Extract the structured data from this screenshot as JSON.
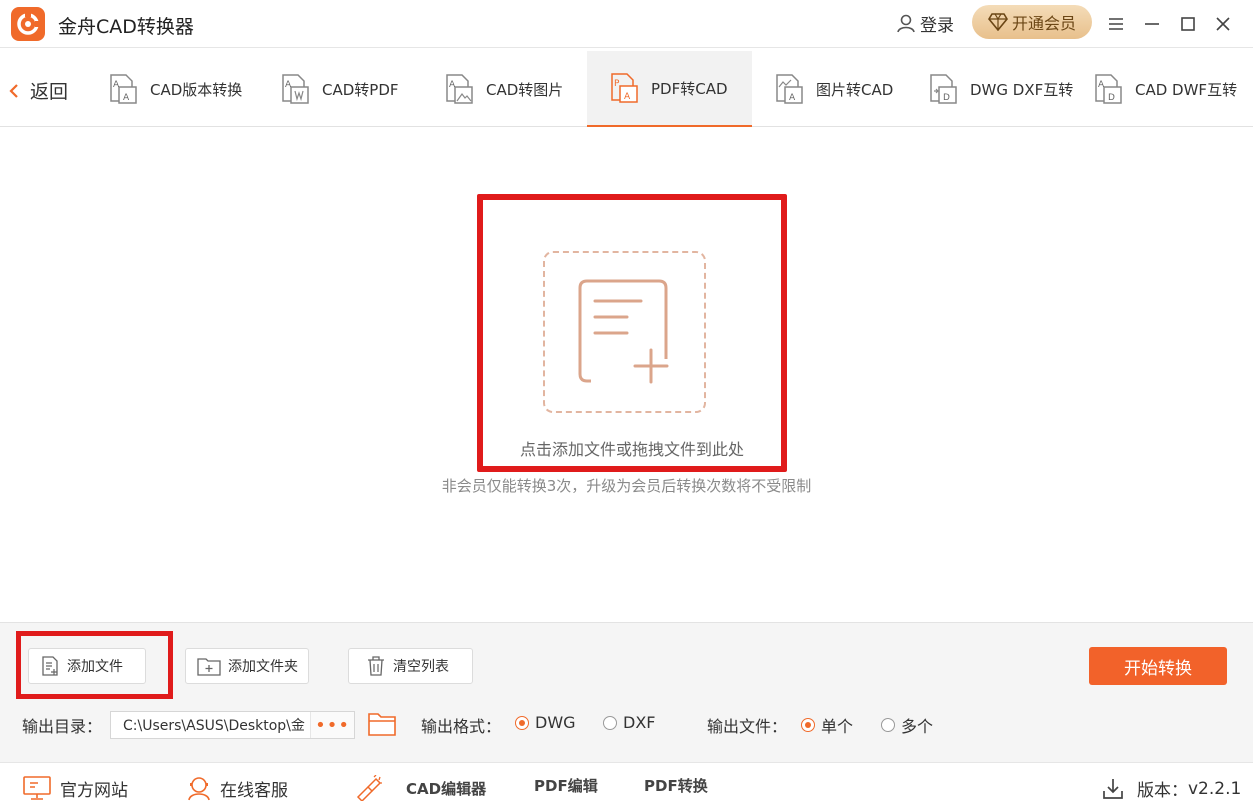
{
  "app": {
    "title": "金舟CAD转换器"
  },
  "header": {
    "login_label": "登录",
    "vip_label": "开通会员"
  },
  "nav": {
    "back_label": "返回",
    "tabs": [
      {
        "label": "CAD版本转换"
      },
      {
        "label": "CAD转PDF"
      },
      {
        "label": "CAD转图片"
      },
      {
        "label": "PDF转CAD",
        "active": true
      },
      {
        "label": "图片转CAD"
      },
      {
        "label": "DWG DXF互转"
      },
      {
        "label": "CAD DWF互转"
      }
    ]
  },
  "main": {
    "drop_text": "点击添加文件或拖拽文件到此处",
    "limit_text": "非会员仅能转换3次，升级为会员后转换次数将不受限制"
  },
  "toolbar": {
    "add_file_label": "添加文件",
    "add_folder_label": "添加文件夹",
    "clear_list_label": "清空列表",
    "start_label": "开始转换",
    "output_dir_label": "输出目录：",
    "output_dir_value": "C:\\Users\\ASUS\\Desktop\\金",
    "browse_label": "•••",
    "format_label": "输出格式：",
    "format_options": [
      {
        "label": "DWG",
        "selected": true
      },
      {
        "label": "DXF",
        "selected": false
      }
    ],
    "output_file_label": "输出文件：",
    "output_file_options": [
      {
        "label": "单个",
        "selected": true
      },
      {
        "label": "多个",
        "selected": false
      }
    ]
  },
  "footer": {
    "website_label": "官方网站",
    "service_label": "在线客服",
    "cad_editor_label": "CAD编辑器",
    "pdf_edit_label": "PDF编辑",
    "pdf_convert_label": "PDF转换",
    "version_label": "版本：",
    "version_value": "v2.2.1"
  },
  "colors": {
    "accent": "#f06a2a",
    "highlight": "#e01b1b",
    "vip_gold": "#e8c08c"
  },
  "icons": [
    "app-logo-icon",
    "user-icon",
    "diamond-icon",
    "menu-icon",
    "minimize-icon",
    "maximize-icon",
    "close-icon",
    "chevron-left-icon",
    "file-convert-icon",
    "file-add-icon",
    "folder-add-icon",
    "trash-icon",
    "folder-icon",
    "monitor-icon",
    "headset-icon",
    "brush-icon",
    "download-icon"
  ]
}
